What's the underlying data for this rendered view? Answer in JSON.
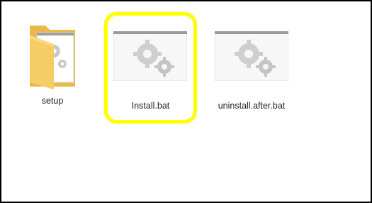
{
  "files": [
    {
      "label": "setup",
      "icon": "folder-icon",
      "type": "folder"
    },
    {
      "label": "Install.bat",
      "icon": "batch-file-icon",
      "type": "batch",
      "selected": true
    },
    {
      "label": "uninstall.after.bat",
      "icon": "batch-file-icon",
      "type": "batch"
    }
  ],
  "colors": {
    "highlight": "#ffff00",
    "folder": "#f2c75c",
    "gear": "#c8c8c8"
  }
}
